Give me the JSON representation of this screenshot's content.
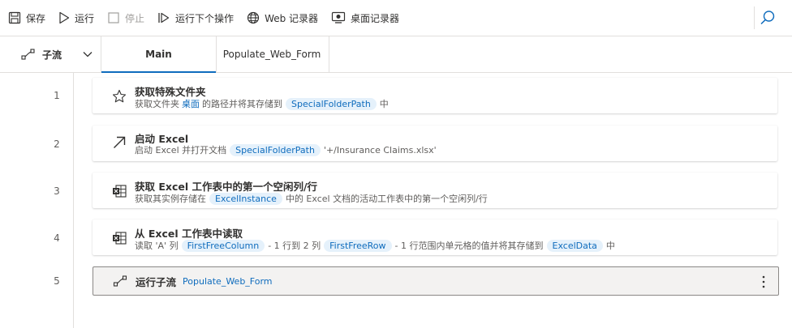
{
  "toolbar": {
    "save": "保存",
    "run": "运行",
    "stop": "停止",
    "run_next": "运行下个操作",
    "web_recorder": "Web 记录器",
    "desktop_recorder": "桌面记录器"
  },
  "tabs": {
    "subflow_label": "子流",
    "main": "Main",
    "populate": "Populate_Web_Form"
  },
  "actions": [
    {
      "line": "1",
      "title": "获取特殊文件夹",
      "d1": "获取文件夹",
      "link": "桌面",
      "d2": "的路径并将其存储到",
      "var1": "SpecialFolderPath",
      "d3": "中"
    },
    {
      "line": "2",
      "title": "启动 Excel",
      "d1": "启动 Excel 并打开文档",
      "var1": "SpecialFolderPath",
      "d2": "'+/Insurance Claims.xlsx'"
    },
    {
      "line": "3",
      "title": "获取 Excel 工作表中的第一个空闲列/行",
      "d1": "获取其实例存储在",
      "var1": "ExcelInstance",
      "d2": "中的 Excel 文档的活动工作表中的第一个空闲列/行"
    },
    {
      "line": "4",
      "title": "从 Excel 工作表中读取",
      "d1": "读取 'A' 列",
      "var1": "FirstFreeColumn",
      "d2": "- 1 行到 2 列",
      "var2": "FirstFreeRow",
      "d3": "- 1 行范围内单元格的值并将其存储到",
      "var3": "ExcelData",
      "d4": "中"
    },
    {
      "line": "5",
      "title": "运行子流",
      "link": "Populate_Web_Form"
    }
  ],
  "colors": {
    "accent": "#0f6cbd",
    "variable_bg": "#e5f1fb",
    "selected_bg": "#f3f2f1"
  }
}
